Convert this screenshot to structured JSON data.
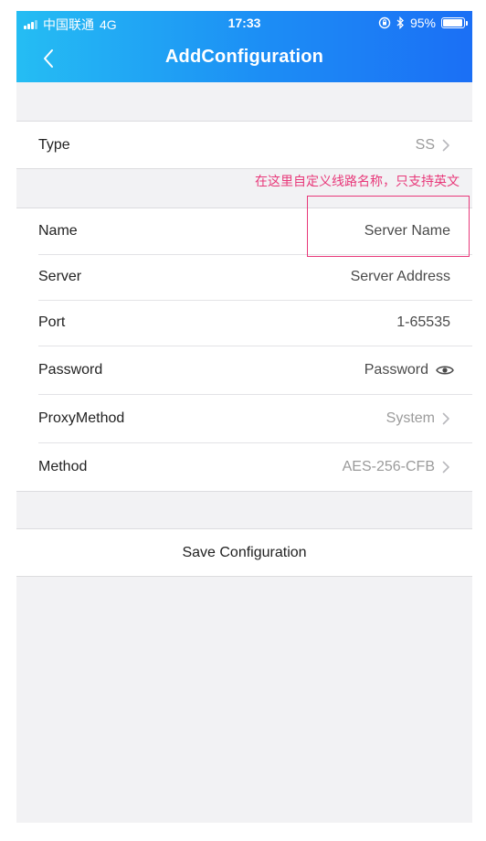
{
  "status_bar": {
    "carrier": "中国联通",
    "network": "4G",
    "time": "17:33",
    "battery": "95%",
    "battery_level": 0.95
  },
  "header": {
    "title": "AddConfiguration",
    "icon": "chevron-left-icon"
  },
  "type_row": {
    "label": "Type",
    "value": "SS"
  },
  "annotation": {
    "text": "在这里自定义线路名称，只支持英文",
    "color": "#e8397a"
  },
  "fields": {
    "name": {
      "label": "Name",
      "placeholder": "Server Name"
    },
    "server": {
      "label": "Server",
      "placeholder": "Server Address"
    },
    "port": {
      "label": "Port",
      "placeholder": "1-65535"
    },
    "password": {
      "label": "Password",
      "placeholder": "Password",
      "icon": "eye-icon"
    },
    "proxy_method": {
      "label": "ProxyMethod",
      "value": "System"
    },
    "method": {
      "label": "Method",
      "value": "AES-256-CFB"
    }
  },
  "save_button": {
    "label": "Save Configuration"
  },
  "colors": {
    "header_gradient_start": "#25bdf3",
    "header_gradient_end": "#1b6ff5",
    "annotation": "#e8397a",
    "background": "#f2f2f4"
  }
}
